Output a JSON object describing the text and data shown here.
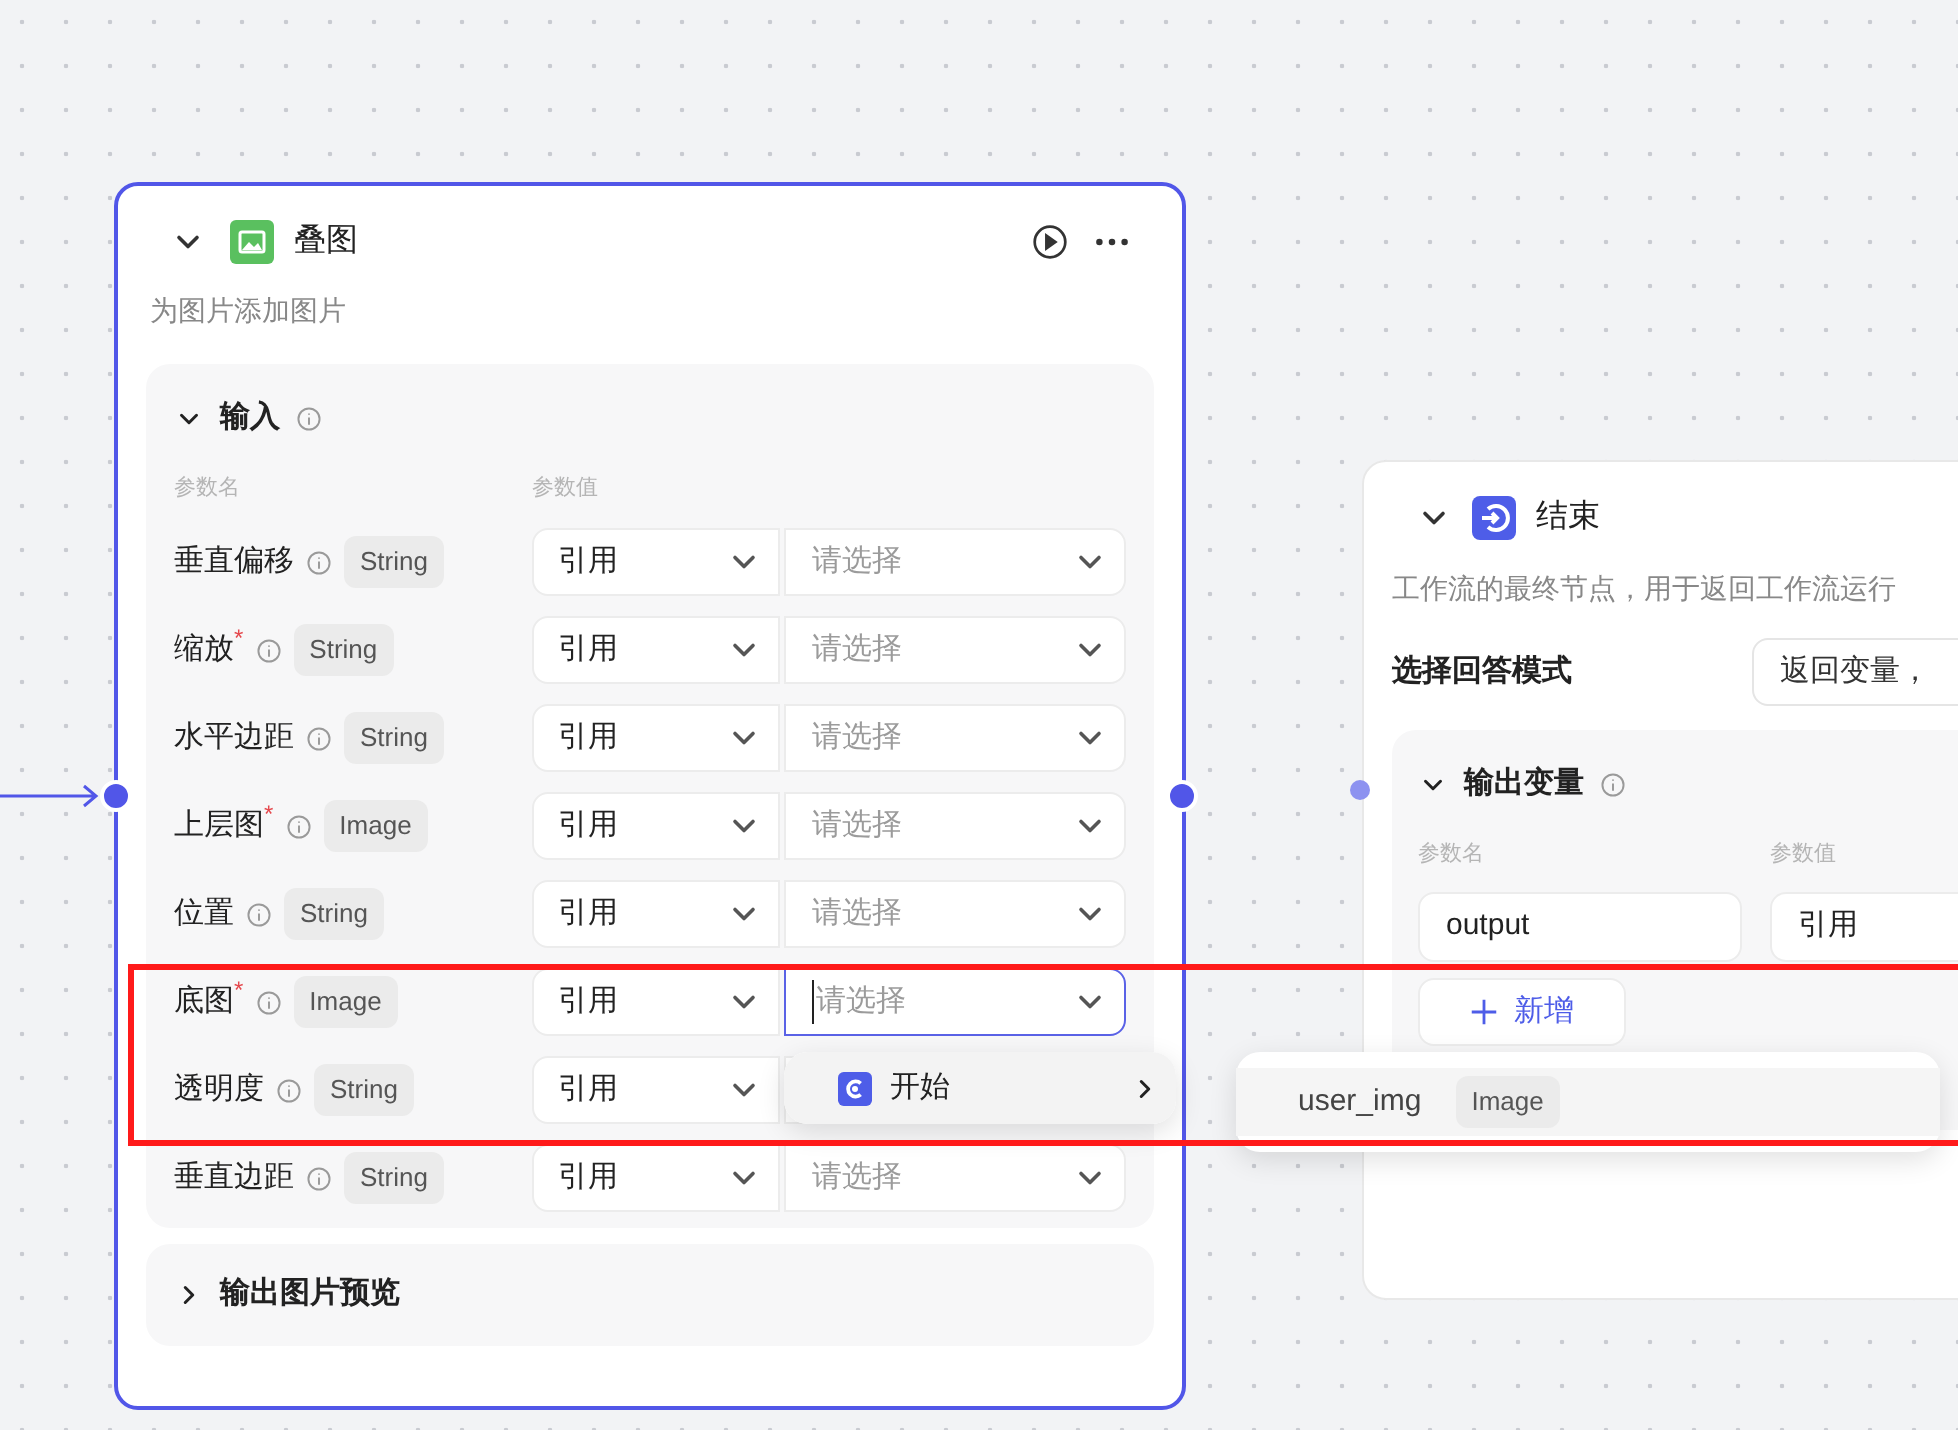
{
  "image_node": {
    "title": "叠图",
    "description": "为图片添加图片",
    "input_section": {
      "title": "输入",
      "expanded": true,
      "column_name": "参数名",
      "column_value": "参数值",
      "rows": [
        {
          "name": "垂直偏移",
          "type": "String",
          "source": "引用",
          "placeholder": "请选择",
          "focused": false
        },
        {
          "name": "缩放$^{*}$",
          "type": "String",
          "source": "引用",
          "placeholder": "请选择",
          "focused": false
        },
        {
          "name": "水平边距",
          "type": "String",
          "source": "引用",
          "placeholder": "请选择",
          "focused": false
        },
        {
          "name": "上层图$^{*}$",
          "type": "Image",
          "source": "引用",
          "placeholder": "请选择",
          "focused": false
        },
        {
          "name": "位置",
          "type": "String",
          "source": "引用",
          "placeholder": "请选择",
          "focused": false
        },
        {
          "name": "底图$^{*}$",
          "type": "Image",
          "source": "引用",
          "placeholder": "请选择",
          "focused": true
        },
        {
          "name": "透明度",
          "type": "String",
          "source": "引用",
          "focused": false
        },
        {
          "name": "垂直边距",
          "type": "String",
          "source": "引用",
          "placeholder": "请选择",
          "focused": false
        }
      ]
    },
    "output_section": {
      "title": "输出图片预览",
      "expanded": false
    }
  },
  "end_node": {
    "title": "结束",
    "description": "工作流的最终节点，用于返回工作流运行",
    "mode_label": "选择回答模式",
    "mode_value": "返回变量，",
    "output_section": {
      "title": "输出变量",
      "expanded": true,
      "column_name": "参数名",
      "column_value": "参数值",
      "rows": [
        {
          "name": "output",
          "source": "引用"
        }
      ],
      "add_button": "新增"
    }
  },
  "dropdown": {
    "items": [
      {
        "label": "开始",
        "selected": true
      }
    ],
    "submenu": [
      {
        "name": "user_img",
        "type": "Image"
      }
    ]
  }
}
